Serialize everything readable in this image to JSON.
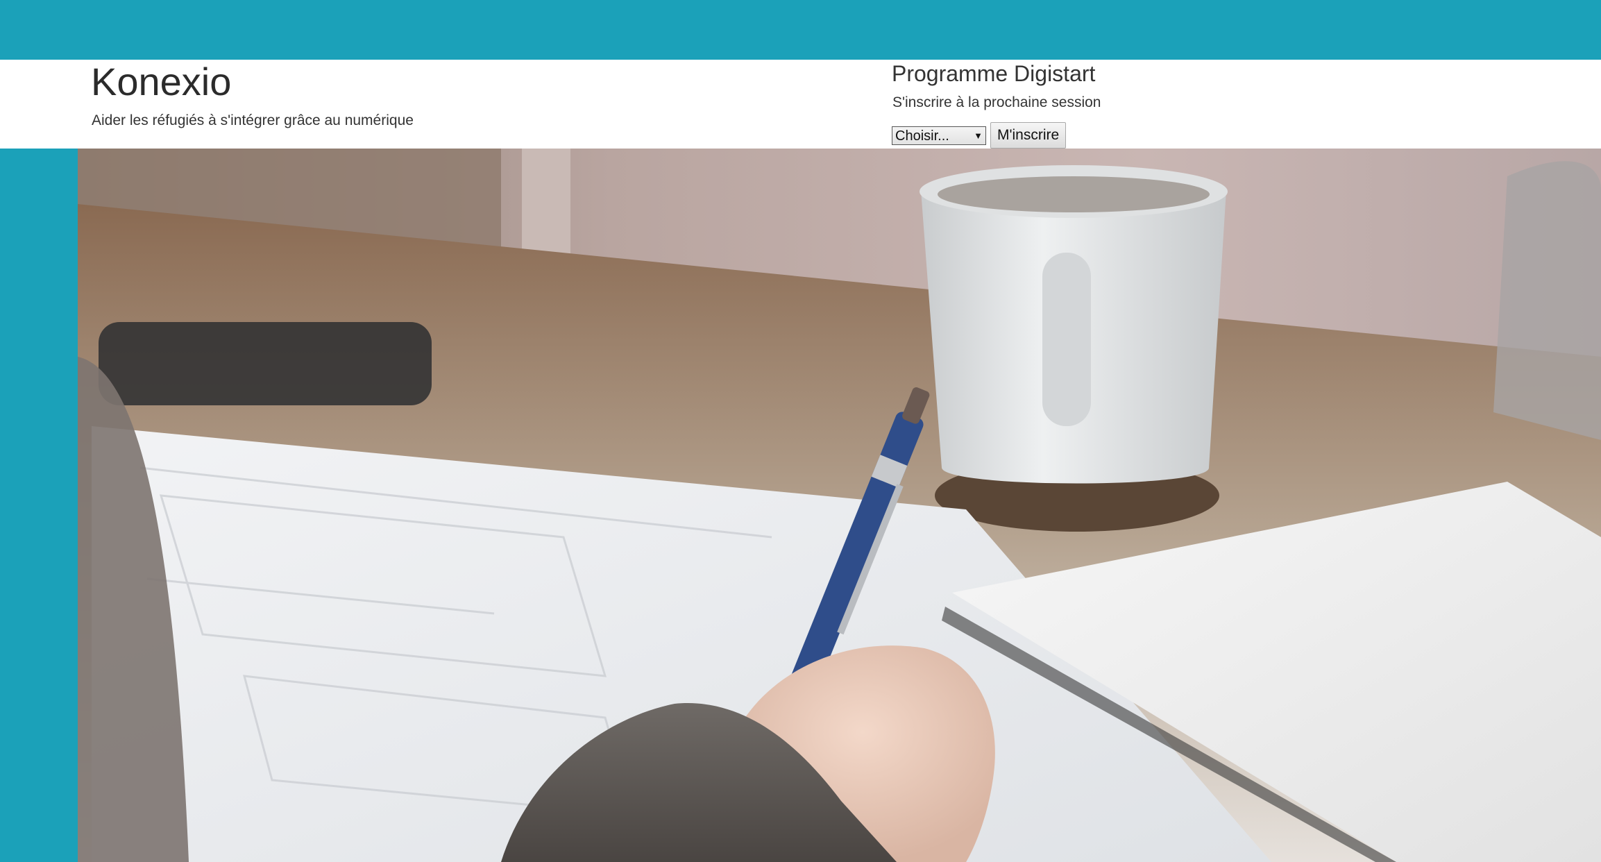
{
  "brand": {
    "title": "Konexio",
    "tagline": "Aider les réfugiés à s'intégrer grâce au numérique"
  },
  "program": {
    "title": "Programme Digistart",
    "subtitle": "S'inscrire à la prochaine session",
    "select_value": "Choisir...",
    "submit_label": "M'inscrire"
  },
  "colors": {
    "accent": "#1ba1b9",
    "header_bg": "#ffffff",
    "text": "#333333"
  },
  "hero": {
    "icon": "hero-photo"
  }
}
